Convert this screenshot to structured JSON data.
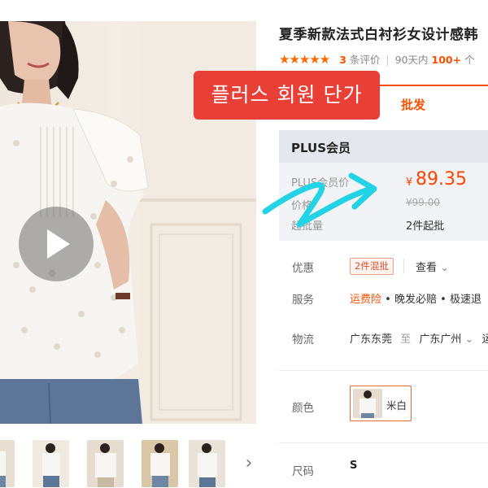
{
  "product": {
    "title": "夏季新款法式白衬衫女设计感韩",
    "rating": {
      "stars": "★★★★★",
      "review_count": "3",
      "review_label": "条评价",
      "separator": "|",
      "sales_period": "90天内",
      "sales_count": "100+",
      "sales_suffix": "个"
    }
  },
  "overlay": {
    "korean_banner": "플러스 회원 단가"
  },
  "tabs": {
    "wholesale": "批发"
  },
  "plus_box": {
    "header": "PLUS会员",
    "price_label": "PLUS会员价",
    "price_symbol": "¥",
    "price_value": "89.35",
    "original_label": "价格",
    "original_price": "¥99.00",
    "moq_label": "起批量",
    "moq_value": "2件起批"
  },
  "details": {
    "discount_label": "优惠",
    "discount_badge": "2件混批",
    "view_link": "查看",
    "view_chevron": "⌄",
    "service_label": "服务",
    "service_items": [
      "运费险",
      "晚发必赔",
      "极速退"
    ],
    "service_dot": "•",
    "logistics_label": "物流",
    "logistics_from": "广东东莞",
    "logistics_to_word": "至",
    "logistics_to": "广东广州",
    "logistics_chevron": "⌄",
    "logistics_trail": "运",
    "color_label": "颜色",
    "color_option": "米白",
    "size_label": "尺码",
    "size_option": "S"
  },
  "gallery": {
    "next_arrow": "›"
  },
  "colors": {
    "accent_orange": "#ff5000",
    "banner_red": "#e83f37",
    "plus_bg": "#f1f3f6",
    "cyan_arrow": "#22d3e6"
  }
}
